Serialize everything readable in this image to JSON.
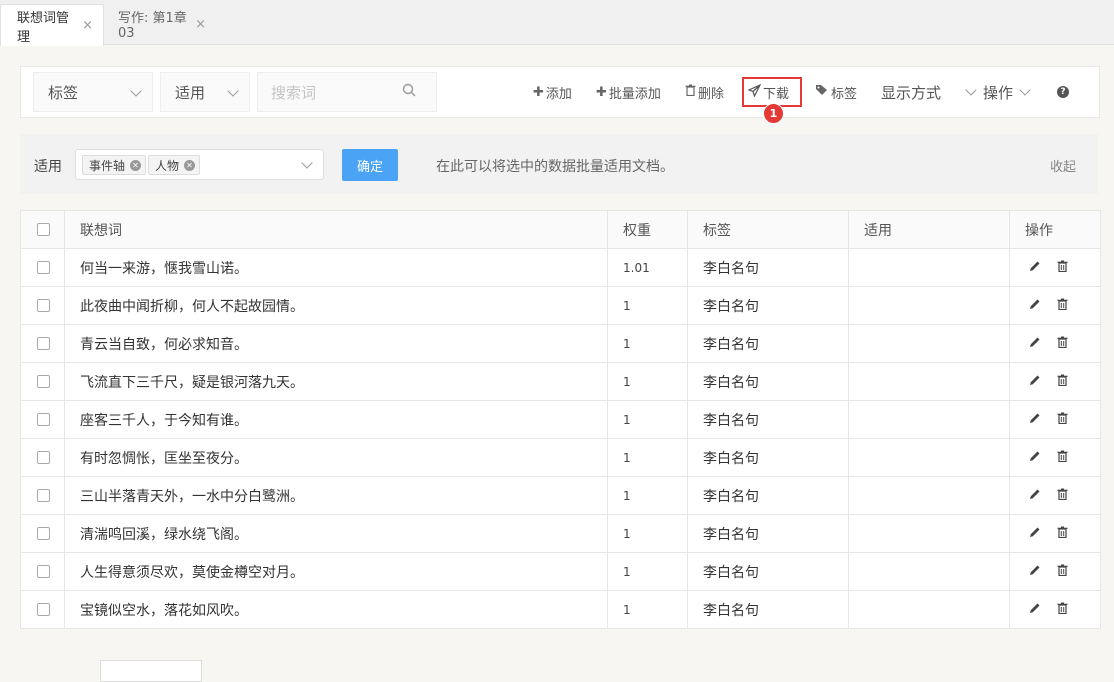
{
  "tabs": [
    {
      "label": "联想词管理",
      "close": "×"
    },
    {
      "label": "写作: 第1章03",
      "close": "×"
    }
  ],
  "toolbar": {
    "tag_select": "标签",
    "apply_select": "适用",
    "search_placeholder": "搜索词",
    "add": "添加",
    "batch_add": "批量添加",
    "delete": "删除",
    "download": "下载",
    "tag": "标签",
    "display_mode": "显示方式",
    "operations": "操作",
    "help_icon": "?",
    "badge": "1"
  },
  "apply_bar": {
    "label": "适用",
    "chips": [
      "事件轴",
      "人物"
    ],
    "confirm": "确定",
    "hint": "在此可以将选中的数据批量适用文档。",
    "collapse": "收起"
  },
  "table": {
    "headers": [
      "联想词",
      "权重",
      "标签",
      "适用",
      "操作"
    ],
    "rows": [
      {
        "word": "何当一来游，惬我雪山诺。",
        "weight": "1.01",
        "tag": "李白名句",
        "apply": ""
      },
      {
        "word": "此夜曲中闻折柳，何人不起故园情。",
        "weight": "1",
        "tag": "李白名句",
        "apply": ""
      },
      {
        "word": "青云当自致，何必求知音。",
        "weight": "1",
        "tag": "李白名句",
        "apply": ""
      },
      {
        "word": "飞流直下三千尺，疑是银河落九天。",
        "weight": "1",
        "tag": "李白名句",
        "apply": ""
      },
      {
        "word": "座客三千人，于今知有谁。",
        "weight": "1",
        "tag": "李白名句",
        "apply": ""
      },
      {
        "word": "有时忽惆怅，匡坐至夜分。",
        "weight": "1",
        "tag": "李白名句",
        "apply": ""
      },
      {
        "word": "三山半落青天外，一水中分白鹭洲。",
        "weight": "1",
        "tag": "李白名句",
        "apply": ""
      },
      {
        "word": "清湍鸣回溪，绿水绕飞阁。",
        "weight": "1",
        "tag": "李白名句",
        "apply": ""
      },
      {
        "word": "人生得意须尽欢，莫使金樽空对月。",
        "weight": "1",
        "tag": "李白名句",
        "apply": ""
      },
      {
        "word": "宝镜似空水，落花如风吹。",
        "weight": "1",
        "tag": "李白名句",
        "apply": ""
      }
    ]
  },
  "icons": {
    "plus": "✚",
    "trash": "🗑",
    "send": "➢",
    "tags": "🏷",
    "edit": "✎",
    "delete": "🗑",
    "search": "🔍"
  },
  "colors": {
    "accent": "#4aa3f4",
    "highlight": "#e53935"
  }
}
